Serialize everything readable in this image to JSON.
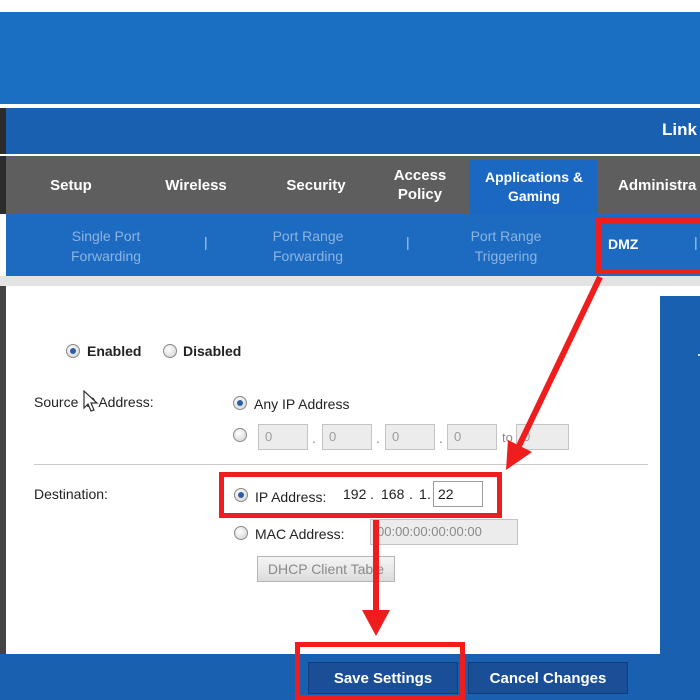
{
  "brand": {
    "title": "Link"
  },
  "nav": {
    "tabs": [
      {
        "label": "Setup"
      },
      {
        "label": "Wireless"
      },
      {
        "label": "Security"
      },
      {
        "label": "Access Policy"
      },
      {
        "label": "Applications & Gaming"
      },
      {
        "label": "Administra"
      }
    ],
    "subtabs": [
      {
        "label": "Single Port Forwarding"
      },
      {
        "label": "Port Range Forwarding"
      },
      {
        "label": "Port Range Triggering"
      },
      {
        "label": "DMZ"
      }
    ],
    "separator": "|"
  },
  "dmz": {
    "enabled_label": "Enabled",
    "disabled_label": "Disabled",
    "source_label": "Source IP Address:",
    "any_ip_label": "Any IP Address",
    "range_from": [
      "0",
      "0",
      "0",
      "0"
    ],
    "range_to_label": "to",
    "range_to_value": "0",
    "destination_label": "Destination:",
    "ip_label": "IP Address:",
    "ip_prefix": [
      "192",
      "168",
      "1"
    ],
    "ip_last": "22",
    "mac_label": "MAC Address:",
    "mac_value": "00:00:00:00:00:00",
    "dhcp_button": "DHCP Client Table",
    "dot": "."
  },
  "footer": {
    "save_label": "Save Settings",
    "cancel_label": "Cancel Changes"
  },
  "colors": {
    "highlight": "#ef1d1d",
    "banner": "#1b6fc2",
    "nav_gray": "#5e5e5e",
    "active_tab": "#1a68c2"
  }
}
